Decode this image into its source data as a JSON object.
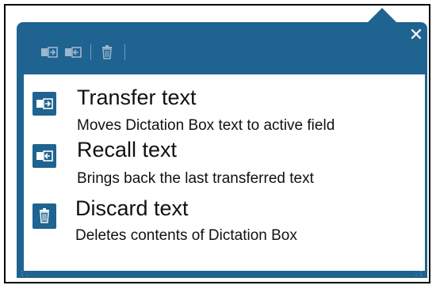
{
  "toolbar": {
    "icons": [
      "transfer-icon",
      "recall-icon",
      "discard-icon"
    ]
  },
  "close_label": "✕",
  "items": [
    {
      "icon": "transfer-icon",
      "title": "Transfer text",
      "desc": "Moves Dictation Box text to active field"
    },
    {
      "icon": "recall-icon",
      "title": "Recall text",
      "desc": "Brings back the last transferred text"
    },
    {
      "icon": "trash-icon",
      "title": "Discard text",
      "desc": "Deletes contents of Dictation Box"
    }
  ],
  "colors": {
    "accent": "#1f6391",
    "icon_fg": "#ffffff",
    "background": "#ffffff"
  }
}
